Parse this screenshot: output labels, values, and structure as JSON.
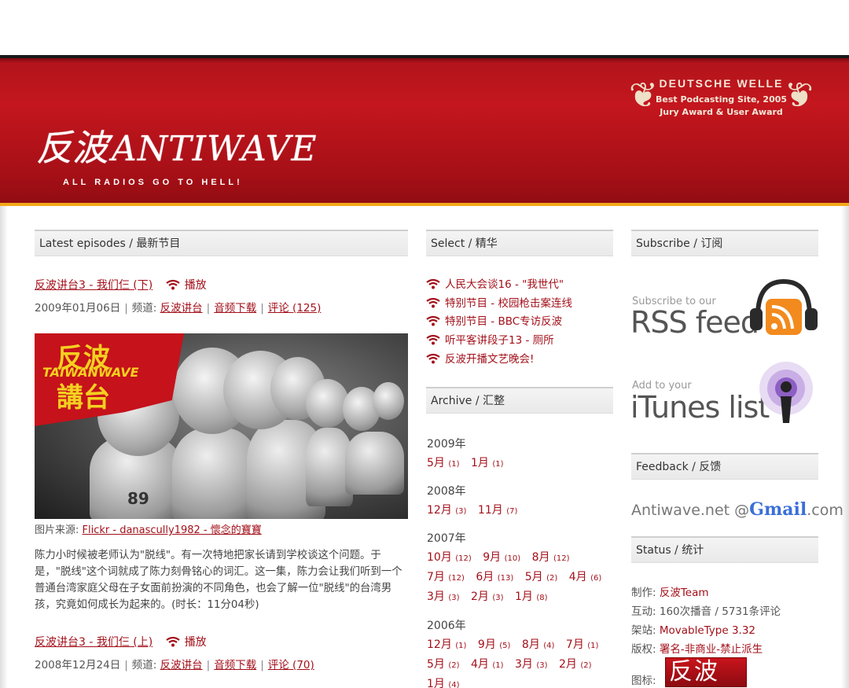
{
  "header": {
    "logo_cn": "反波",
    "logo_en": "ANTIWAVE",
    "tagline": "ALL RADIOS GO TO HELL!",
    "award_line1": "DEUTSCHE WELLE",
    "award_line2": "Best Podcasting Site, 2005",
    "award_line3": "Jury Award & User Award"
  },
  "left": {
    "section_title": "Latest episodes / 最新节目",
    "episodes": [
      {
        "title": "反波讲台3 - 我们仨 (下)",
        "play_label": "播放",
        "date": "2009年01月06日",
        "channel_prefix": "频道:",
        "channel": "反波讲台",
        "download": "音频下载",
        "comments": "评论 (125)"
      },
      {
        "title": "反波讲台3 - 我们仨 (上)",
        "play_label": "播放",
        "date": "2008年12月24日",
        "channel_prefix": "频道:",
        "channel": "反波讲台",
        "download": "音频下载",
        "comments": "评论 (70)"
      }
    ],
    "photo_tag_top": "反波",
    "photo_tag_mid": "TAIWANWAVE",
    "photo_tag_bottom": "講台",
    "photo_jersey": "89",
    "caption_prefix": "图片来源:",
    "caption_link": "Flickr - danascully1982 - 懷念的寶寶",
    "description": "陈力小时候被老师认为\"脱线\"。有一次特地把家长请到学校谈这个问题。于是，\"脱线\"这个词就成了陈力刻骨铭心的词汇。这一集，陈力会让我们听到一个普通台湾家庭父母在子女面前扮演的不同角色，也会了解一位\"脱线\"的台湾男孩，究竟如何成长为起来的。(时长：11分04秒)"
  },
  "middle": {
    "select_title": "Select / 精华",
    "select_items": [
      "人民大会谈16 - \"我世代\"",
      "特别节目 - 校园枪击案连线",
      "特别节目 - BBC专访反波",
      "听平客讲段子13 - 厕所",
      "反波开播文艺晚会!"
    ],
    "archive_title": "Archive / 汇整",
    "archive": [
      {
        "year": "2009年",
        "rows": [
          [
            [
              "5月",
              "(1)"
            ],
            [
              "1月",
              "(1)"
            ]
          ]
        ]
      },
      {
        "year": "2008年",
        "rows": [
          [
            [
              "12月",
              "(3)"
            ],
            [
              "11月",
              "(7)"
            ]
          ]
        ]
      },
      {
        "year": "2007年",
        "rows": [
          [
            [
              "10月",
              "(12)"
            ],
            [
              "9月",
              "(10)"
            ],
            [
              "8月",
              "(12)"
            ]
          ],
          [
            [
              "7月",
              "(12)"
            ],
            [
              "6月",
              "(13)"
            ],
            [
              "5月",
              "(2)"
            ],
            [
              "4月",
              "(6)"
            ]
          ],
          [
            [
              "3月",
              "(3)"
            ],
            [
              "2月",
              "(3)"
            ],
            [
              "1月",
              "(8)"
            ]
          ]
        ]
      },
      {
        "year": "2006年",
        "rows": [
          [
            [
              "12月",
              "(1)"
            ],
            [
              "9月",
              "(5)"
            ],
            [
              "8月",
              "(4)"
            ],
            [
              "7月",
              "(1)"
            ]
          ],
          [
            [
              "5月",
              "(2)"
            ],
            [
              "4月",
              "(1)"
            ],
            [
              "3月",
              "(3)"
            ],
            [
              "2月",
              "(2)"
            ]
          ],
          [
            [
              "1月",
              "(4)"
            ]
          ]
        ]
      }
    ]
  },
  "right": {
    "subscribe_title": "Subscribe / 订阅",
    "rss_small": "Subscribe to our",
    "rss_big": "RSS feed",
    "itunes_small": "Add to your",
    "itunes_big": "iTunes list",
    "feedback_title": "Feedback / 反馈",
    "gmail_prefix": "Antiwave.net @",
    "gmail_brand": "Gmail",
    "gmail_suffix": ".com",
    "status_title": "Status / 统计",
    "status": [
      {
        "label": "制作:",
        "value": "反波Team",
        "link": true
      },
      {
        "label": "互动:",
        "value": "160次播音 / 5731条评论",
        "link": false
      },
      {
        "label": "架站:",
        "value": "MovableType 3.32",
        "link": true
      },
      {
        "label": "版权:",
        "value": "署名-非商业-禁止派生",
        "link": true
      },
      {
        "label": "图标:",
        "value": "",
        "link": false
      }
    ],
    "icon_badge_text": "反波"
  },
  "colors": {
    "brand_red": "#c4161e",
    "link_red": "#a3101a",
    "accent_orange": "#f3a91b"
  }
}
